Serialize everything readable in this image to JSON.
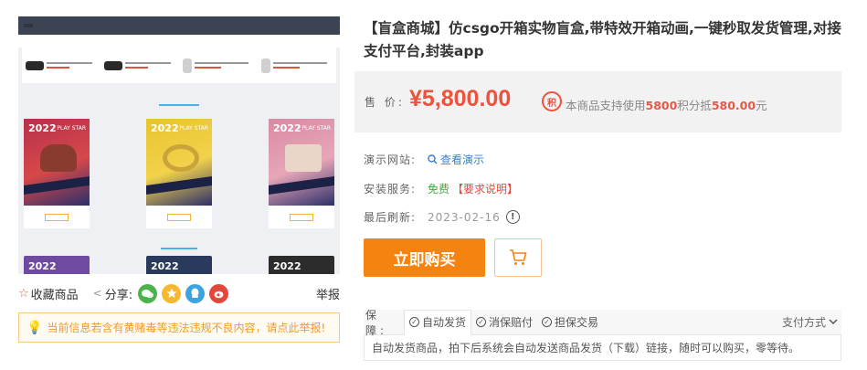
{
  "product": {
    "title": "【盲盒商城】仿csgo开箱实物盲盒,带特效开箱动画,一键秒取发货管理,对接支付平台,封装app"
  },
  "price": {
    "label": "售 价:",
    "value": "¥5,800.00",
    "points_icon": "积",
    "points_text_prefix": "本商品支持使用",
    "points_amount": "5800",
    "points_text_mid": "积分抵",
    "points_deduct": "580.00",
    "points_text_suffix": "元"
  },
  "info": {
    "demo_label": "演示网站:",
    "demo_link": "查看演示",
    "service_label": "安装服务:",
    "service_value": "免费",
    "service_req": "【要求说明】",
    "refresh_label": "最后刷新:",
    "refresh_date": "2023-02-16",
    "refresh_info_icon": "!"
  },
  "actions": {
    "buy_label": "立即购买",
    "cart_icon": "cart-icon"
  },
  "share": {
    "favorite_icon": "☆",
    "favorite_label": "收藏商品",
    "share_label": "分享:",
    "report_label": "举报"
  },
  "warning": {
    "icon": "💡",
    "text": "当前信息若含有黄赌毒等违法违规不良内容，请点此举报!"
  },
  "guarantee": {
    "label": "保 障:",
    "tabs": [
      {
        "label": "自动发货"
      },
      {
        "label": "消保赔付"
      },
      {
        "label": "担保交易"
      }
    ],
    "payment_label": "支付方式",
    "description": "自动发货商品，拍下后系统会自动发送商品发货（下载）链接，随时可以购买，零等待。"
  },
  "screenshot": {
    "cards": [
      {
        "year": "2022",
        "tag": "PLAY STAR"
      },
      {
        "year": "2022",
        "tag": "PLAY STAR"
      },
      {
        "year": "2022",
        "tag": "PLAY STAR"
      }
    ],
    "row2": [
      {
        "year": "2022"
      },
      {
        "year": "2022"
      },
      {
        "year": "2022"
      }
    ]
  },
  "colors": {
    "price": "#f0513d",
    "buy_button": "#f5830f",
    "link": "#3a7fd5",
    "free": "#3ab03e"
  }
}
